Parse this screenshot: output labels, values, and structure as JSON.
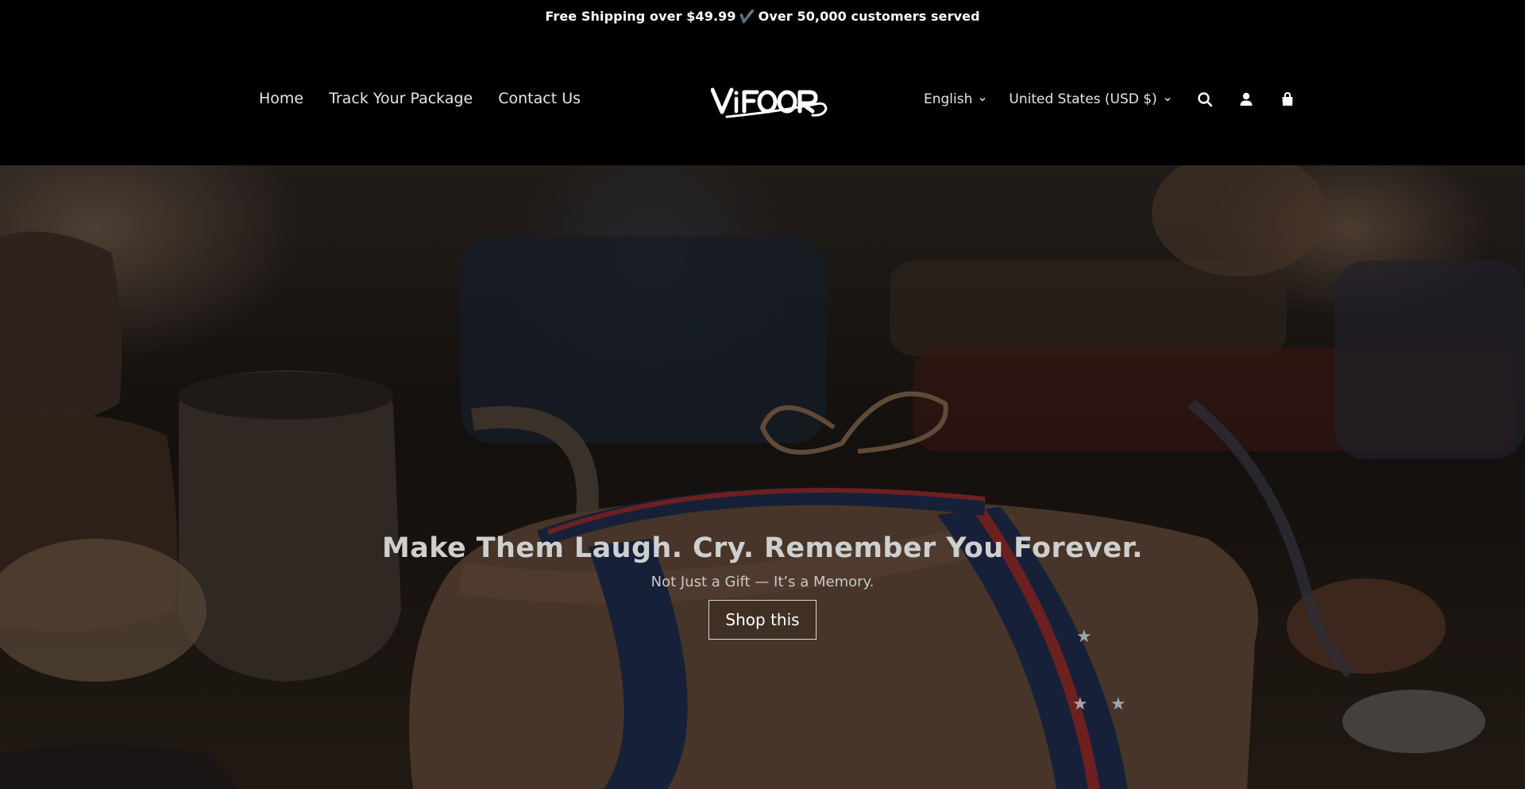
{
  "announcement": {
    "left_text": "Free Shipping over $49.99",
    "check_symbol": "✔️",
    "right_text": "Over 50,000 customers served"
  },
  "nav": {
    "items": [
      {
        "label": "Home"
      },
      {
        "label": "Track Your Package"
      },
      {
        "label": "Contact Us"
      }
    ]
  },
  "logo": {
    "text": "VIFOOR"
  },
  "localization": {
    "language": "English",
    "country": "United States (USD $)"
  },
  "icons": [
    "search-icon",
    "account-icon",
    "cart-icon"
  ],
  "hero": {
    "title": "Make Them Laugh. Cry. Remember You Forever.",
    "subtitle": "Not Just a Gift — It’s a Memory.",
    "button_label": "Shop this"
  },
  "colors": {
    "background": "#000000",
    "text": "#ffffff",
    "check": "#9aa34f"
  }
}
